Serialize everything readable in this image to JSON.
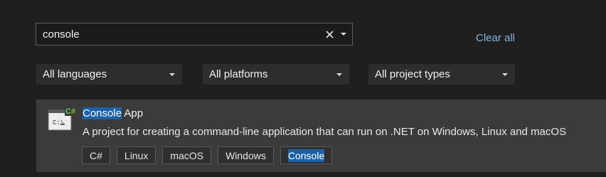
{
  "search": {
    "value": "console",
    "clear_icon": "close-icon",
    "dropdown_icon": "chevron-down-icon"
  },
  "clear_all": "Clear all",
  "filters": {
    "language": "All languages",
    "platform": "All platforms",
    "project_type": "All project types"
  },
  "template": {
    "icon": "console-app-csharp-icon",
    "title_highlight": "Console",
    "title_rest": " App",
    "description": "A project for creating a command-line application that can run on .NET on Windows, Linux and macOS",
    "tags": [
      "C#",
      "Linux",
      "macOS",
      "Windows"
    ],
    "highlighted_tag": "Console"
  },
  "colors": {
    "background": "#1f1f1f",
    "link": "#7fb4df",
    "highlight": "#1c60a8",
    "item_bg": "#3b3b3b"
  }
}
